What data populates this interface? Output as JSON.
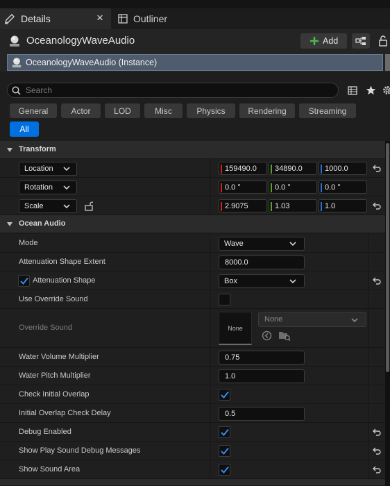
{
  "tabs": {
    "details_label": "Details",
    "outliner_label": "Outliner",
    "close_glyph": "×"
  },
  "header": {
    "actor_name": "OceanologyWaveAudio",
    "add_label": "Add",
    "instance_label": "OceanologyWaveAudio (Instance)"
  },
  "search": {
    "placeholder": "Search"
  },
  "filters": {
    "items": [
      "General",
      "Actor",
      "LOD",
      "Misc",
      "Physics",
      "Rendering",
      "Streaming"
    ],
    "all_label": "All"
  },
  "transform": {
    "title": "Transform",
    "location": {
      "label": "Location",
      "x": "159490.0",
      "y": "34890.0",
      "z": "1000.0"
    },
    "rotation": {
      "label": "Rotation",
      "x": "0.0 °",
      "y": "0.0 °",
      "z": "0.0 °"
    },
    "scale": {
      "label": "Scale",
      "x": "2.9075",
      "y": "1.03",
      "z": "1.0"
    }
  },
  "ocean_audio": {
    "title": "Ocean Audio",
    "mode": {
      "label": "Mode",
      "value": "Wave"
    },
    "attenuation_shape_extent": {
      "label": "Attenuation Shape Extent",
      "value": "8000.0"
    },
    "attenuation_shape": {
      "label": "Attenuation Shape",
      "value": "Box",
      "enabled": true
    },
    "use_override_sound": {
      "label": "Use Override Sound",
      "checked": false
    },
    "override_sound": {
      "label": "Override Sound",
      "thumb_label": "None",
      "value": "None"
    },
    "water_volume_multiplier": {
      "label": "Water Volume Multiplier",
      "value": "0.75"
    },
    "water_pitch_multiplier": {
      "label": "Water Pitch Multiplier",
      "value": "1.0"
    },
    "check_initial_overlap": {
      "label": "Check Initial Overlap",
      "checked": true
    },
    "initial_overlap_check_delay": {
      "label": "Initial Overlap Check Delay",
      "value": "0.5"
    },
    "debug_enabled": {
      "label": "Debug Enabled",
      "checked": true
    },
    "show_play_sound_debug_messages": {
      "label": "Show Play Sound Debug Messages",
      "checked": true
    },
    "show_sound_area": {
      "label": "Show Sound Area",
      "checked": true
    }
  },
  "colors": {
    "accent_blue": "#0070e0",
    "axis_x": "#c4271e",
    "axis_y": "#5aa02c",
    "axis_z": "#2f6fcf",
    "add_green": "#4cb54c"
  }
}
